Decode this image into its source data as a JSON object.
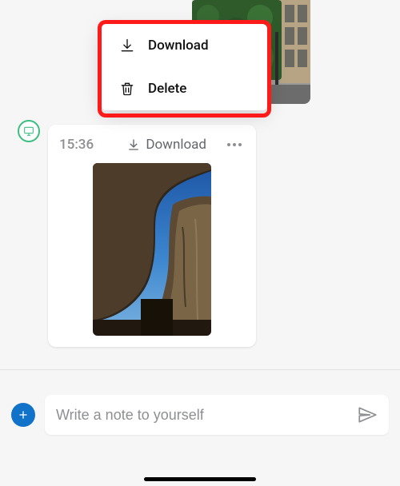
{
  "context_menu": {
    "items": [
      {
        "label": "Download",
        "icon": "download-icon"
      },
      {
        "label": "Delete",
        "icon": "trash-icon"
      }
    ]
  },
  "previous_message": {
    "image_alt": "green hedge with beige building"
  },
  "message": {
    "time": "15:36",
    "download_label": "Download",
    "image_alt": "rocky arch against blue sky"
  },
  "composer": {
    "placeholder": "Write a note to yourself"
  }
}
